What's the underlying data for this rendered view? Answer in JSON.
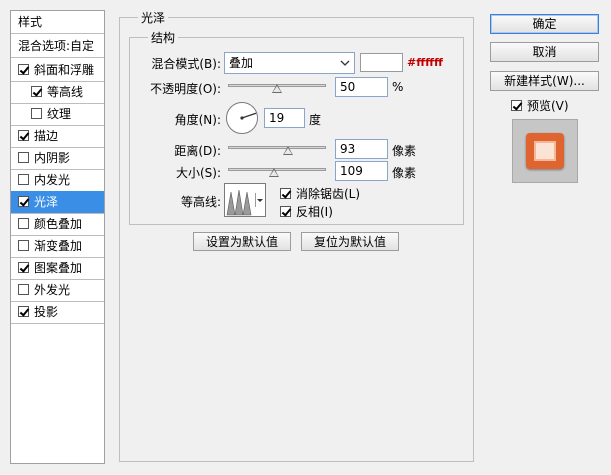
{
  "sidebar": {
    "header": "样式",
    "blend_options": "混合选项:自定",
    "items": [
      {
        "label": "斜面和浮雕",
        "checked": true
      },
      {
        "label": "等高线",
        "checked": true
      },
      {
        "label": "纹理",
        "checked": false
      },
      {
        "label": "描边",
        "checked": true
      },
      {
        "label": "内阴影",
        "checked": false
      },
      {
        "label": "内发光",
        "checked": false
      },
      {
        "label": "光泽",
        "checked": true
      },
      {
        "label": "颜色叠加",
        "checked": false
      },
      {
        "label": "渐变叠加",
        "checked": false
      },
      {
        "label": "图案叠加",
        "checked": true
      },
      {
        "label": "外发光",
        "checked": false
      },
      {
        "label": "投影",
        "checked": true
      }
    ]
  },
  "satin": {
    "title": "光泽",
    "structure_title": "结构",
    "blend_mode_label": "混合模式(B):",
    "blend_mode_value": "叠加",
    "color_hex": "#ffffff",
    "opacity_label": "不透明度(O):",
    "opacity_value": "50",
    "opacity_unit": "%",
    "angle_label": "角度(N):",
    "angle_value": "19",
    "angle_unit": "度",
    "distance_label": "距离(D):",
    "distance_value": "93",
    "distance_unit": "像素",
    "size_label": "大小(S):",
    "size_value": "109",
    "size_unit": "像素",
    "contour_label": "等高线:",
    "anti_alias_label": "消除锯齿(L)",
    "anti_alias_checked": true,
    "invert_label": "反相(I)",
    "invert_checked": true,
    "make_default": "设置为默认值",
    "reset_default": "复位为默认值"
  },
  "right": {
    "ok": "确定",
    "cancel": "取消",
    "new_style": "新建样式(W)...",
    "preview_label": "预览(V)",
    "preview_checked": true
  },
  "colors": {
    "accent": "#3a8ee6",
    "hex_text": "#c00000",
    "preview_orange": "#e0642f"
  }
}
